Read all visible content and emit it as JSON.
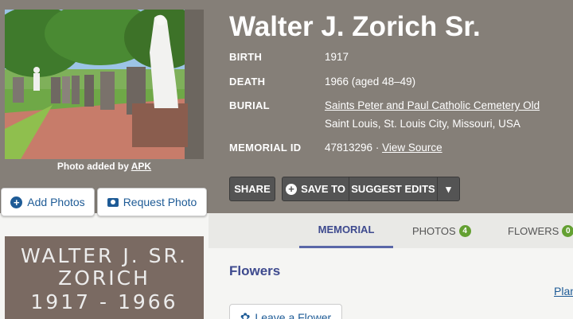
{
  "memorial": {
    "name": "Walter J. Zorich Sr.",
    "facts": {
      "birth_label": "BIRTH",
      "birth_value": "1917",
      "death_label": "DEATH",
      "death_value": "1966 (aged 48–49)",
      "burial_label": "BURIAL",
      "burial_cemetery": "Saints Peter and Paul Catholic Cemetery Old",
      "burial_location": "Saint Louis, St. Louis City, Missouri, USA",
      "memorial_id_label": "MEMORIAL ID",
      "memorial_id_value": "47813296 ·",
      "view_source": "View Source"
    }
  },
  "photo": {
    "caption_prefix": "Photo added by",
    "added_by": "APK"
  },
  "side_actions": {
    "add_photos": "Add Photos",
    "request_photo": "Request Photo"
  },
  "toolbar": {
    "share": "SHARE",
    "save_to": "SAVE TO",
    "suggest_edits": "SUGGEST EDITS",
    "dropdown_caret": "▾"
  },
  "tabs": [
    {
      "label": "MEMORIAL",
      "active": true
    },
    {
      "label": "PHOTOS",
      "count": "4"
    },
    {
      "label": "FLOWERS",
      "count": "0"
    }
  ],
  "headstone": {
    "line1": "WALTER J. SR.",
    "line2": "ZORICH",
    "line3": "1917 - 1966"
  },
  "flowers": {
    "section_title": "Flowers",
    "plant_link": "Plan",
    "leave_button": "Leave a Flower"
  },
  "colors": {
    "hero_bg": "#857f78",
    "link_blue": "#1e5b96",
    "tab_active": "#3e4a8e",
    "badge_green": "#64a032"
  }
}
